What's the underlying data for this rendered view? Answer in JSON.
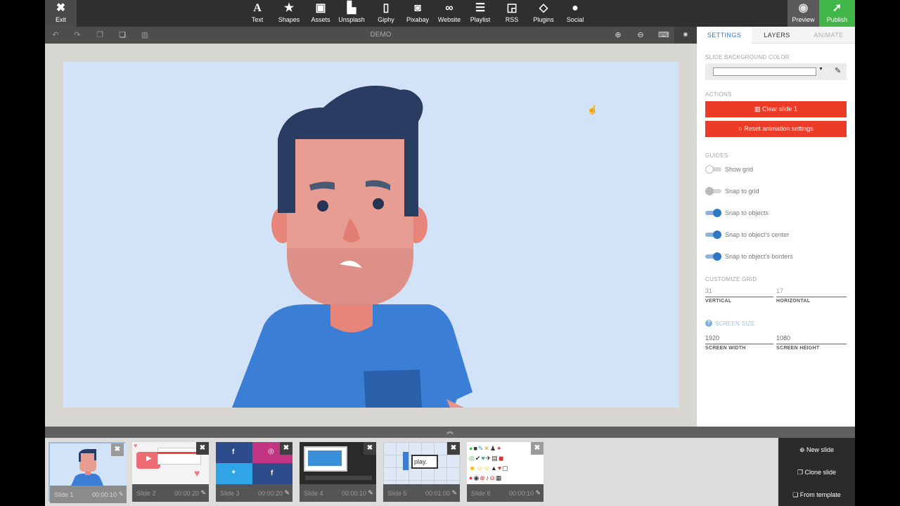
{
  "toolbar": {
    "exit_label": "Exit",
    "items": [
      {
        "label": "Text",
        "icon": "text-icon",
        "glyph": "A"
      },
      {
        "label": "Shapes",
        "icon": "star-icon",
        "glyph": "★"
      },
      {
        "label": "Assets",
        "icon": "image-icon",
        "glyph": "▣"
      },
      {
        "label": "Unsplash",
        "icon": "unsplash-icon",
        "glyph": "▙"
      },
      {
        "label": "Giphy",
        "icon": "file-icon",
        "glyph": "▯"
      },
      {
        "label": "Pixabay",
        "icon": "camera-icon",
        "glyph": "◙"
      },
      {
        "label": "Website",
        "icon": "link-icon",
        "glyph": "∞"
      },
      {
        "label": "Playlist",
        "icon": "list-icon",
        "glyph": "☰"
      },
      {
        "label": "RSS",
        "icon": "rss-icon",
        "glyph": "◲"
      },
      {
        "label": "Plugins",
        "icon": "diamond-icon",
        "glyph": "◇"
      },
      {
        "label": "Social",
        "icon": "users-icon",
        "glyph": "●"
      }
    ],
    "preview_label": "Preview",
    "publish_label": "Publish"
  },
  "subbar": {
    "title": "DEMO"
  },
  "panel": {
    "tabs": [
      "SETTINGS",
      "LAYERS",
      "ANIMATE"
    ],
    "bg_color_label": "SLIDE BACKGROUND COLOR",
    "actions_label": "ACTIONS",
    "clear_slide_label": "Clear slide 1",
    "reset_anim_label": "Reset animation settings",
    "guides_label": "GUIDES",
    "guides": [
      {
        "label": "Show grid",
        "on": false
      },
      {
        "label": "Snap to grid",
        "on": false
      },
      {
        "label": "Snap to objects",
        "on": true
      },
      {
        "label": "Snap to object's center",
        "on": true
      },
      {
        "label": "Snap to object's borders",
        "on": true
      }
    ],
    "customize_grid_label": "CUSTOMIZE GRID",
    "grid_vertical": "31",
    "grid_vertical_label": "VERTICAL",
    "grid_horizontal": "17",
    "grid_horizontal_label": "HORIZONTAL",
    "screen_size_label": "SCREEN SIZE",
    "screen_width": "1920",
    "screen_width_label": "SCREEN WIDTH",
    "screen_height": "1080",
    "screen_height_label": "SCREEN HEIGHT"
  },
  "slides": [
    {
      "name": "Slide 1",
      "duration": "00:00:10"
    },
    {
      "name": "Slide 2",
      "duration": "00:00:20"
    },
    {
      "name": "Slide 3",
      "duration": "00:00:20"
    },
    {
      "name": "Slide 4",
      "duration": "00:00:10"
    },
    {
      "name": "Slide 5",
      "duration": "00:01:00"
    },
    {
      "name": "Slide 6",
      "duration": "00:00:10"
    }
  ],
  "slide_thumb_texts": {
    "slide5_logo": "play."
  },
  "slide_actions": {
    "new_slide": "New slide",
    "clone_slide": "Clone slide",
    "from_template": "From template"
  },
  "colors": {
    "accent_blue": "#2e78c7",
    "danger_red": "#ec3c28",
    "publish_green": "#42b549",
    "stage_bg": "#d3e3f7"
  }
}
